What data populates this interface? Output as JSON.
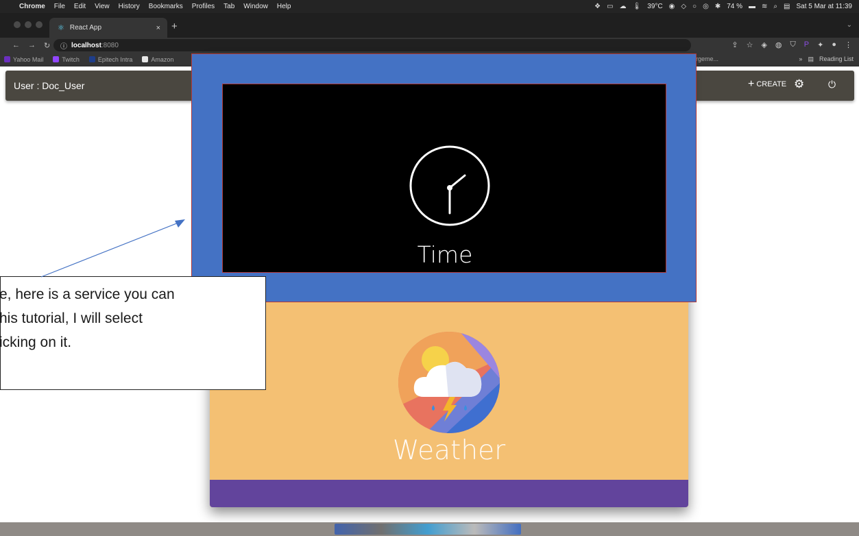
{
  "menubar": {
    "app": "Chrome",
    "items": [
      "File",
      "Edit",
      "View",
      "History",
      "Bookmarks",
      "Profiles",
      "Tab",
      "Window",
      "Help"
    ],
    "temperature": "39°C",
    "battery": "74 %",
    "datetime": "Sat 5 Mar at 11:39"
  },
  "tab": {
    "title": "React App",
    "close": "×",
    "new": "+"
  },
  "address": {
    "host": "localhost",
    "port": ":8080"
  },
  "bookmarks": {
    "items": [
      "Yahoo Mail",
      "Twitch",
      "Epitech Intra",
      "Amazon"
    ],
    "partial": "rgeme...",
    "more": "»",
    "reading_list": "Reading List"
  },
  "app": {
    "user_label": "User : Doc_User",
    "create_label": "CREATE",
    "create_icon": "plus-icon",
    "settings_icon": "gear-icon",
    "power_icon": "power-icon"
  },
  "services": {
    "time": {
      "label": "Time",
      "icon": "clock-icon"
    },
    "weather": {
      "label": "Weather",
      "icon": "weather-icon"
    }
  },
  "callout": {
    "lines": [
      "e, here is a service you can",
      "his tutorial, I will select",
      "icking on it."
    ]
  },
  "colors": {
    "selected_tile": "#4472c4",
    "weather_tile": "#f4c073",
    "purple_bar": "#62449c",
    "header": "#4a4740"
  }
}
